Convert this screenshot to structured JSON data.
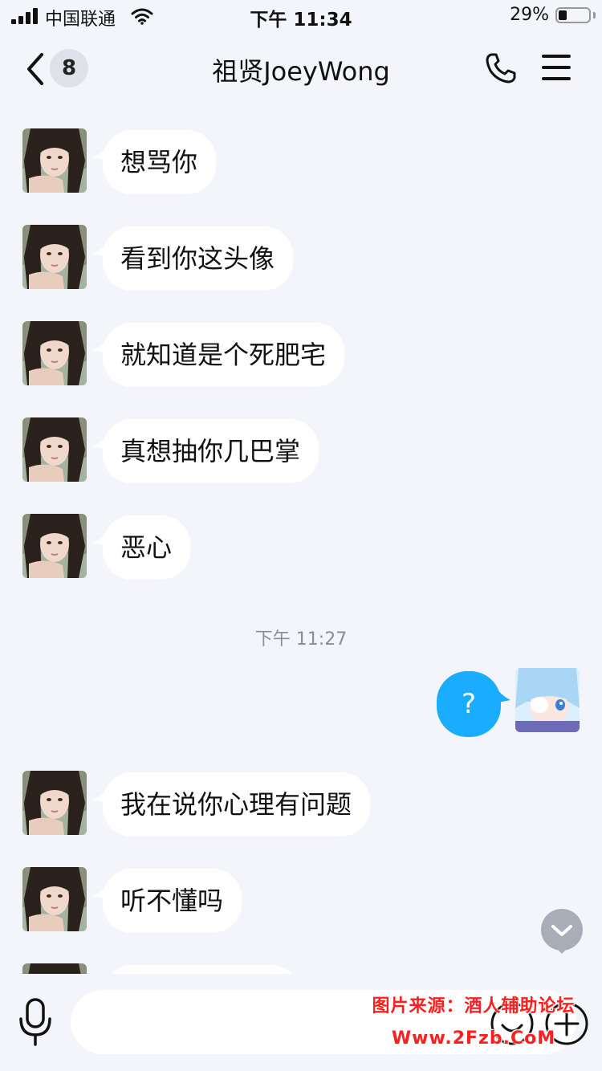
{
  "status_bar": {
    "carrier": "中国联通",
    "time": "下午 11:34",
    "battery_percent_text": "29%",
    "battery_level": 0.29
  },
  "nav": {
    "unread_count": "8",
    "title": "祖贤JoeyWong"
  },
  "messages": [
    {
      "side": "in",
      "text": "想骂你"
    },
    {
      "side": "in",
      "text": "看到你这头像"
    },
    {
      "side": "in",
      "text": "就知道是个死肥宅"
    },
    {
      "side": "in",
      "text": "真想抽你几巴掌"
    },
    {
      "side": "in",
      "text": "恶心"
    },
    {
      "type": "timestamp",
      "text": "下午 11:27"
    },
    {
      "side": "out",
      "text": "?"
    },
    {
      "side": "in",
      "text": "我在说你心理有问题"
    },
    {
      "side": "in",
      "text": "听不懂吗"
    }
  ],
  "input": {
    "placeholder": "",
    "value": ""
  },
  "watermark": {
    "line1": "图片来源：酒人辅助论坛",
    "line2": "Www.2Fzb.CoM"
  },
  "colors": {
    "background": "#f4f5fa",
    "outgoing_bubble": "#1aadff",
    "incoming_bubble": "#ffffff",
    "watermark": "#ff1f1f"
  }
}
